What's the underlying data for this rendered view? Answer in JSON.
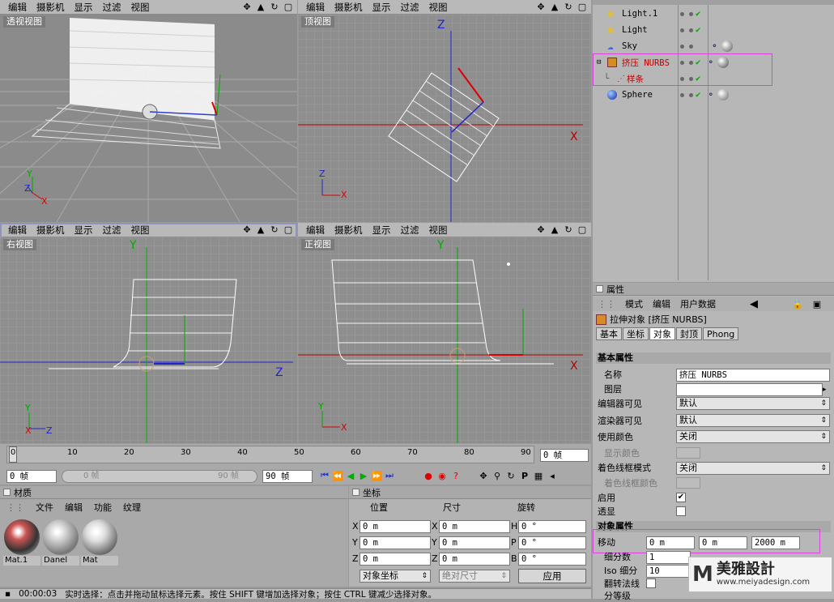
{
  "viewport_menu": [
    "编辑",
    "摄影机",
    "显示",
    "过滤",
    "视图"
  ],
  "viewports": {
    "perspective": "透视视图",
    "top": "顶视图",
    "right": "右视图",
    "front": "正视图"
  },
  "axes": {
    "x": "X",
    "y": "Y",
    "z": "Z"
  },
  "objects": [
    {
      "name": "Light.1",
      "icon": "light-icon",
      "color": "#000"
    },
    {
      "name": "Light",
      "icon": "light-icon",
      "color": "#000"
    },
    {
      "name": "Sky",
      "icon": "sky-icon",
      "color": "#000"
    },
    {
      "name": "挤压 NURBS",
      "icon": "extrude-nurbs-icon",
      "color": "#c00000"
    },
    {
      "name": "样条",
      "icon": "spline-icon",
      "color": "#c00000"
    },
    {
      "name": "Sphere",
      "icon": "sphere-icon",
      "color": "#000"
    }
  ],
  "attributes": {
    "panel_title": "属性",
    "menu": [
      "模式",
      "编辑",
      "用户数据"
    ],
    "object_title": "拉伸对象 [挤压 NURBS]",
    "tabs": [
      "基本",
      "坐标",
      "对象",
      "封顶",
      "Phong"
    ],
    "active_tab": "对象",
    "section_basic": "基本属性",
    "rows": {
      "name_label": "名称",
      "name_value": "挤压 NURBS",
      "layer_label": "图层",
      "editor_vis_label": "编辑器可见",
      "editor_vis_value": "默认",
      "render_vis_label": "渲染器可见",
      "render_vis_value": "默认",
      "use_color_label": "使用颜色",
      "use_color_value": "关闭",
      "display_color_label": "显示颜色",
      "wire_mode_label": "着色线框模式",
      "wire_mode_value": "关闭",
      "wire_color_label": "着色线框颜色",
      "enabled_label": "启用",
      "xray_label": "透显"
    },
    "section_object": "对象属性",
    "object_rows": {
      "move_label": "移动",
      "move_x": "0 m",
      "move_y": "0 m",
      "move_z": "2000 m",
      "subdiv_label": "细分数",
      "subdiv_value": "1",
      "iso_label": "Iso 细分",
      "iso_value": "10",
      "flip_label": "翻转法线",
      "hier_label": "分等级"
    }
  },
  "timeline": {
    "ticks": [
      "0",
      "10",
      "20",
      "30",
      "40",
      "50",
      "60",
      "70",
      "80",
      "90"
    ],
    "current_frame": "0 帧",
    "start_frame": "0 帧",
    "range_start": "0 帧",
    "range_end": "90 帧",
    "end_frame": "90 帧"
  },
  "materials": {
    "title": "材质",
    "menu": [
      "文件",
      "编辑",
      "功能",
      "纹理"
    ],
    "items": [
      {
        "name": "Mat.1"
      },
      {
        "name": "Danel"
      },
      {
        "name": "Mat"
      }
    ]
  },
  "coords": {
    "title": "坐标",
    "headers": [
      "位置",
      "尺寸",
      "旋转"
    ],
    "rows": [
      {
        "a": "X",
        "pos": "0 m",
        "b": "X",
        "size": "0 m",
        "c": "H",
        "rot": "0 °"
      },
      {
        "a": "Y",
        "pos": "0 m",
        "b": "Y",
        "size": "0 m",
        "c": "P",
        "rot": "0 °"
      },
      {
        "a": "Z",
        "pos": "0 m",
        "b": "Z",
        "size": "0 m",
        "c": "B",
        "rot": "0 °"
      }
    ],
    "mode": "对象坐标",
    "size_mode": "绝对尺寸",
    "apply": "应用"
  },
  "status": {
    "time": "00:00:03",
    "message": "实时选择：点击并拖动鼠标选择元素。按住 SHIFT 键增加选择对象；按住 CTRL 键减少选择对象。"
  },
  "watermark": {
    "brand": "美雅設計",
    "url": "www.meiyadesign.com"
  },
  "colors": {
    "highlight": "#e040e0",
    "accent_red": "#c00000"
  }
}
